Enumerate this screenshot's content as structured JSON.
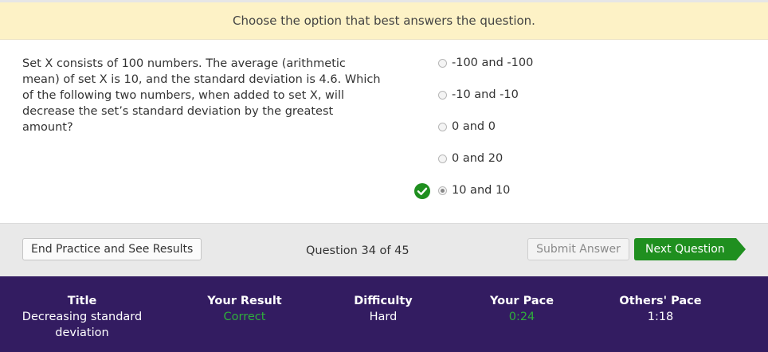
{
  "instruction": "Choose the option that best answers the question.",
  "question": "Set X consists of 100 numbers. The average (arithmetic mean) of set X is 10, and the standard deviation is 4.6. Which of the following two numbers, when added to set X, will decrease the set’s standard deviation by the greatest amount?",
  "options": [
    {
      "label": "-100 and -100"
    },
    {
      "label": "-10 and -10"
    },
    {
      "label": "0 and 0"
    },
    {
      "label": "0 and 20"
    },
    {
      "label": "10 and 10"
    }
  ],
  "selected_option": "10 and 10",
  "correct_indicator_icon": "check-circle-icon",
  "footer": {
    "end_button": "End Practice and See Results",
    "counter": "Question 34 of 45",
    "submit_button": "Submit Answer",
    "next_button": "Next Question"
  },
  "stats": {
    "title_label": "Title",
    "title_value": "Decreasing standard deviation",
    "result_label": "Your Result",
    "result_value": "Correct",
    "difficulty_label": "Difficulty",
    "difficulty_value": "Hard",
    "pace_label": "Your Pace",
    "pace_value": "0:24",
    "others_label": "Others' Pace",
    "others_value": "1:18"
  },
  "colors": {
    "instruction_bg": "#fdf2c6",
    "stats_bg": "#331c61",
    "next_button": "#1f8f1f",
    "correct_green": "#2fae3b"
  }
}
